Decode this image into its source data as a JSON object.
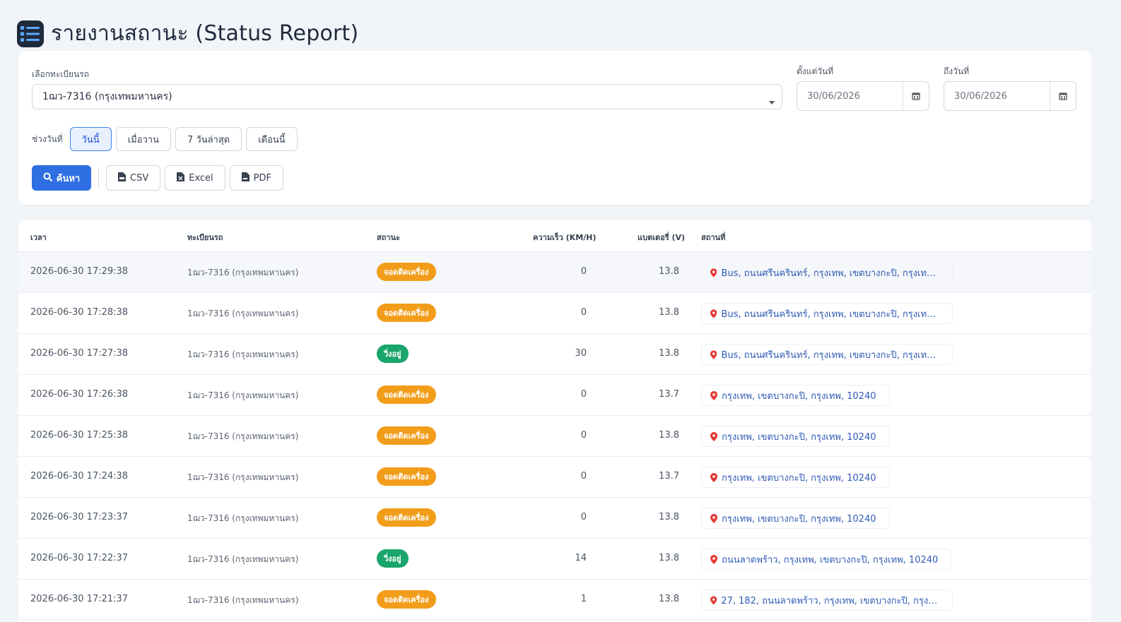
{
  "header": {
    "title": "รายงานสถานะ (Status Report)",
    "icon": "checklist-icon"
  },
  "filters": {
    "vehicle_label": "เลือกทะเบียนรถ",
    "vehicle_value": "1ฌว-7316 (กรุงเทพมหานคร)",
    "from_label": "ตั้งแต่วันที่",
    "from_value": "30/06/2026",
    "to_label": "ถึงวันที่",
    "to_value": "30/06/2026",
    "range_label": "ช่วงวันที่",
    "ranges": [
      "วันนี้",
      "เมื่อวาน",
      "7 วันล่าสุด",
      "เดือนนี้"
    ],
    "active_range": "วันนี้",
    "search_label": "ค้นหา",
    "csv_label": "CSV",
    "excel_label": "Excel",
    "pdf_label": "PDF"
  },
  "table": {
    "columns": [
      "เวลา",
      "ทะเบียนรถ",
      "สถานะ",
      "ความเร็ว (KM/H)",
      "แบตเตอรี่ (V)",
      "สถานที่"
    ],
    "rows": [
      {
        "time": "2026-06-30 17:29:38",
        "plate": "1ฌว-7316 (กรุงเทพมหานคร)",
        "status": "จอดติดเครื่อง",
        "status_color": "#f29d1a",
        "speed": "0",
        "battery": "13.8",
        "location": "Bus, ถนนศรีนครินทร์, กรุงเทพ, เขตบางกะปิ, กรุงเทพ, 1..."
      },
      {
        "time": "2026-06-30 17:28:38",
        "plate": "1ฌว-7316 (กรุงเทพมหานคร)",
        "status": "จอดติดเครื่อง",
        "status_color": "#f29d1a",
        "speed": "0",
        "battery": "13.8",
        "location": "Bus, ถนนศรีนครินทร์, กรุงเทพ, เขตบางกะปิ, กรุงเทพ, 1..."
      },
      {
        "time": "2026-06-30 17:27:38",
        "plate": "1ฌว-7316 (กรุงเทพมหานคร)",
        "status": "วิ่งอยู่",
        "status_color": "#19a56b",
        "speed": "30",
        "battery": "13.8",
        "location": "Bus, ถนนศรีนครินทร์, กรุงเทพ, เขตบางกะปิ, กรุงเทพ, 1..."
      },
      {
        "time": "2026-06-30 17:26:38",
        "plate": "1ฌว-7316 (กรุงเทพมหานคร)",
        "status": "จอดติดเครื่อง",
        "status_color": "#f29d1a",
        "speed": "0",
        "battery": "13.7",
        "location": "กรุงเทพ, เขตบางกะปิ, กรุงเทพ, 10240"
      },
      {
        "time": "2026-06-30 17:25:38",
        "plate": "1ฌว-7316 (กรุงเทพมหานคร)",
        "status": "จอดติดเครื่อง",
        "status_color": "#f29d1a",
        "speed": "0",
        "battery": "13.8",
        "location": "กรุงเทพ, เขตบางกะปิ, กรุงเทพ, 10240"
      },
      {
        "time": "2026-06-30 17:24:38",
        "plate": "1ฌว-7316 (กรุงเทพมหานคร)",
        "status": "จอดติดเครื่อง",
        "status_color": "#f29d1a",
        "speed": "0",
        "battery": "13.7",
        "location": "กรุงเทพ, เขตบางกะปิ, กรุงเทพ, 10240"
      },
      {
        "time": "2026-06-30 17:23:37",
        "plate": "1ฌว-7316 (กรุงเทพมหานคร)",
        "status": "จอดติดเครื่อง",
        "status_color": "#f29d1a",
        "speed": "0",
        "battery": "13.8",
        "location": "กรุงเทพ, เขตบางกะปิ, กรุงเทพ, 10240"
      },
      {
        "time": "2026-06-30 17:22:37",
        "plate": "1ฌว-7316 (กรุงเทพมหานคร)",
        "status": "วิ่งอยู่",
        "status_color": "#19a56b",
        "speed": "14",
        "battery": "13.8",
        "location": "ถนนลาดพร้าว, กรุงเทพ, เขตบางกะปิ, กรุงเทพ, 10240"
      },
      {
        "time": "2026-06-30 17:21:37",
        "plate": "1ฌว-7316 (กรุงเทพมหานคร)",
        "status": "จอดติดเครื่อง",
        "status_color": "#f29d1a",
        "speed": "1",
        "battery": "13.8",
        "location": "27, 182, ถนนลาดพร้าว, กรุงเทพ, เขตบางกะปิ, กรุงเทพ, ..."
      }
    ]
  },
  "colors": {
    "primary": "#2f6fe4",
    "parked": "#f29d1a",
    "moving": "#19a56b",
    "link": "#2f5bb5",
    "pin": "#e53935"
  }
}
